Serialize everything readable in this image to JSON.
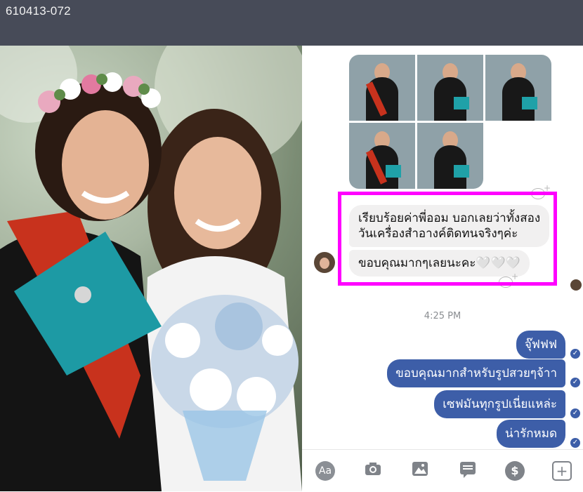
{
  "window": {
    "title": "610413-072"
  },
  "chat": {
    "timestamp": "4:25 PM",
    "incoming": [
      {
        "line1": "เรียบร้อยค่าพี่ออม บอกเลยว่าทั้งสอง",
        "line2": "วันเครื่องสำอางค์ติดทนจริงๆค่ะ"
      },
      {
        "text": "ขอบคุณมากๆเลยนะคะ🤍🤍🤍"
      }
    ],
    "outgoing": [
      {
        "text": "จุ๊ฟฟฟ"
      },
      {
        "text": "ขอบคุณมากสำหรับรูปสวยๆจ้าา"
      },
      {
        "text": "เซฟมันทุกรูปเนี่ยแหล่ะ"
      },
      {
        "text": "น่ารักหมด"
      }
    ],
    "photo_count": 5
  },
  "toolbar": {
    "aa_label": "Aa",
    "icons": [
      "text-format-icon",
      "camera-icon",
      "image-icon",
      "sticker-icon",
      "payment-icon",
      "plus-icon"
    ]
  },
  "colors": {
    "topbar": "#474b58",
    "outgoing_bubble": "#3d5ea8",
    "incoming_bubble": "#f1f0f0",
    "highlight": "#ff00ff"
  }
}
